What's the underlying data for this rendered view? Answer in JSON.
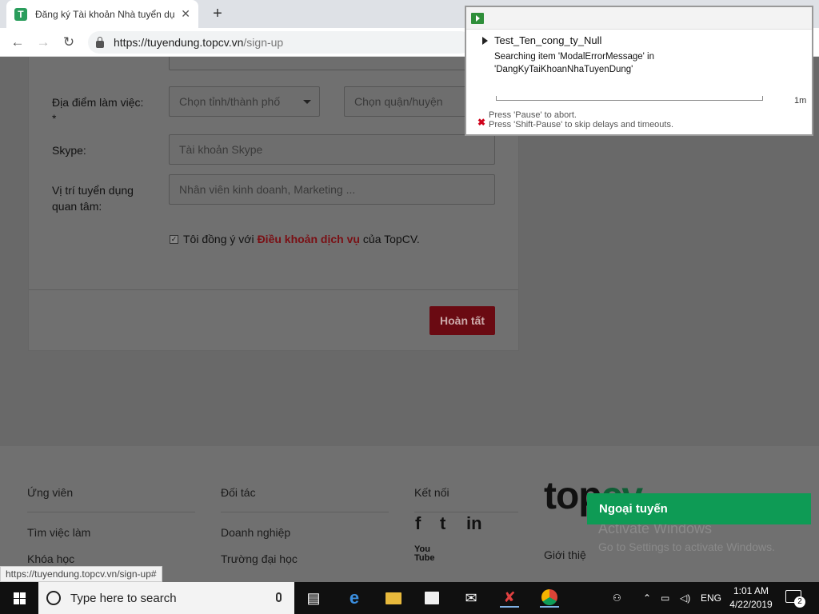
{
  "browser": {
    "tab_title": "Đăng ký Tài khoản Nhà tuyển dụ",
    "favicon_letter": "T",
    "tab_close": "✕",
    "new_tab": "+",
    "url_host": "https://tuyendung.topcv.vn",
    "url_path": "/sign-up",
    "status_url": "https://tuyendung.topcv.vn/sign-up#"
  },
  "form": {
    "location_label": "Địa điểm làm việc:",
    "required_mark": "*",
    "city_placeholder": "Chọn tỉnh/thành phố",
    "district_placeholder": "Chọn quận/huyện",
    "skype_label": "Skype:",
    "skype_placeholder": "Tài khoản Skype",
    "position_label": "Vị trí tuyển dụng quan tâm:",
    "position_placeholder": "Nhân viên kinh doanh, Marketing ...",
    "agree_prefix": "Tôi đồng ý với",
    "agree_terms": "Điều khoản dịch vụ",
    "agree_suffix": "của TopCV.",
    "submit_label": "Hoàn tất"
  },
  "footer": {
    "col1_title": "Ứng viên",
    "col1_links": [
      "Tìm việc làm",
      "Khóa học"
    ],
    "col2_title": "Đối tác",
    "col2_links": [
      "Doanh nghiệp",
      "Trường đại học"
    ],
    "col3_title": "Kết nối",
    "social": [
      "f",
      "t",
      "in",
      "You Tube"
    ],
    "logo_a": "top",
    "logo_b": "cv",
    "partial_link": "Giới thiệ",
    "activate_title": "Activate Windows",
    "activate_sub": "Go to Settings to activate Windows.",
    "online_label": "Ngoại tuyến"
  },
  "overlay": {
    "test_name": "Test_Ten_cong_ty_Null",
    "status_line1": "Searching item 'ModalErrorMessage' in",
    "status_line2": "'DangKyTaiKhoanNhaTuyenDung'",
    "elapsed": "1m",
    "hint1": "Press 'Pause' to abort.",
    "hint2": "Press 'Shift-Pause' to skip delays and timeouts.",
    "progress": 0
  },
  "taskbar": {
    "search_placeholder": "Type here to search",
    "language": "ENG",
    "time": "1:01 AM",
    "date": "4/22/2019",
    "notification_count": "2"
  }
}
